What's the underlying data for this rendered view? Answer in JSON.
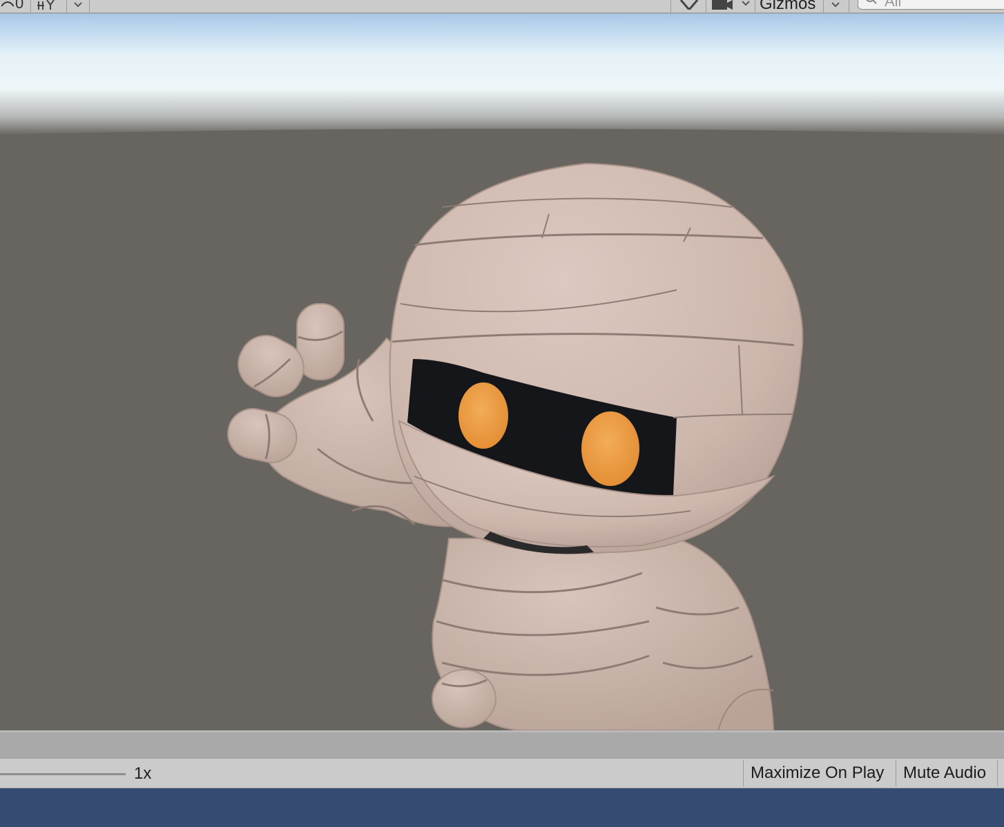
{
  "toolbar": {
    "visibility_count": "0",
    "gizmos_label": "Gizmos",
    "search_placeholder": "All"
  },
  "game_view": {
    "subject": "mummy-character"
  },
  "bottom_bar": {
    "scale_value": "1x",
    "maximize_on_play_label": "Maximize On Play",
    "mute_audio_label": "Mute Audio"
  },
  "colors": {
    "toolbar_bg": "#cbcbcb",
    "ground": "#686460",
    "sky_top": "#a8c8e8",
    "bandage": "#d2bcb2",
    "eyes": "#f0a24a",
    "taskbar": "#364b72"
  }
}
